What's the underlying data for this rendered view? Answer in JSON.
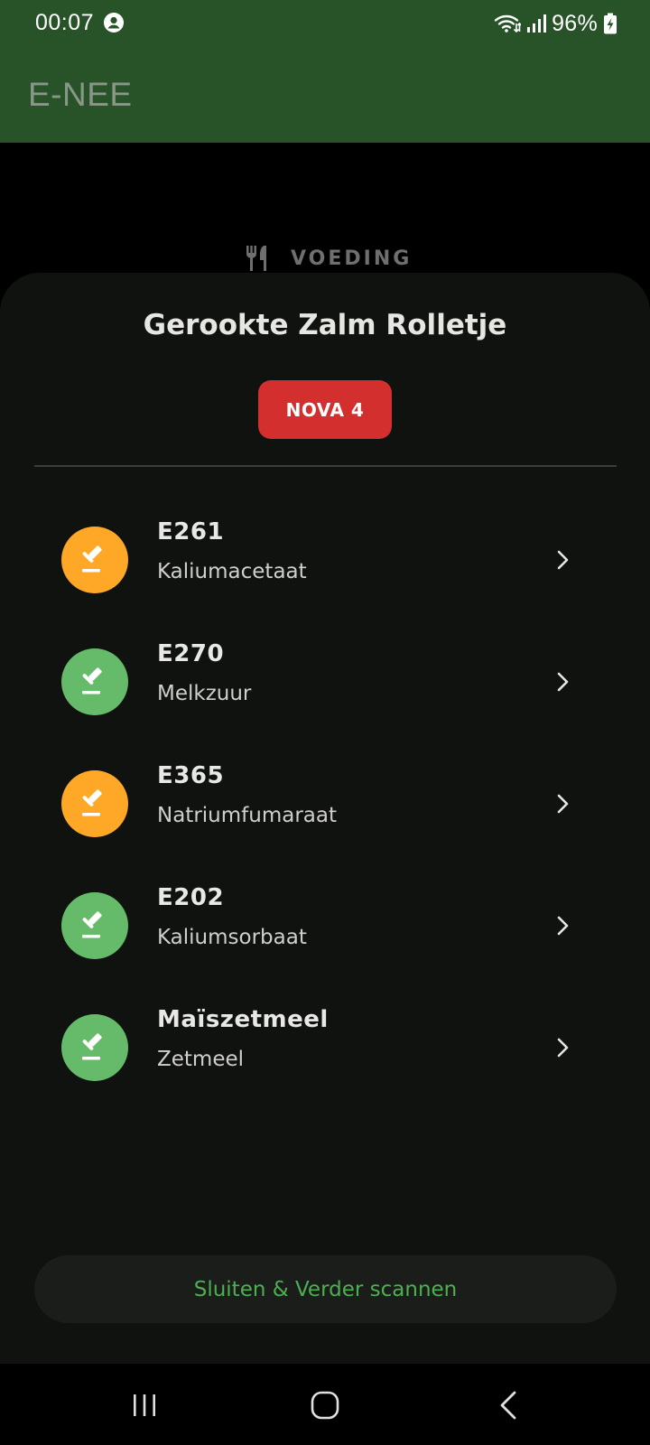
{
  "status_bar": {
    "time": "00:07",
    "battery_percent": "96%",
    "icons": [
      "account-icon",
      "wifi-icon",
      "signal-icon",
      "battery-charging-icon"
    ]
  },
  "app_bar": {
    "title": "E-NEE"
  },
  "category": {
    "label": "VOEDING",
    "icon": "fork-knife-icon"
  },
  "sheet": {
    "product_title": "Gerookte Zalm Rolletje",
    "nova_badge": "NOVA 4",
    "items": [
      {
        "code": "E261",
        "name": "Kaliumacetaat",
        "status_color": "#FFA726",
        "icon": "gavel-icon"
      },
      {
        "code": "E270",
        "name": "Melkzuur",
        "status_color": "#66BB6A",
        "icon": "gavel-icon"
      },
      {
        "code": "E365",
        "name": "Natriumfumaraat",
        "status_color": "#FFA726",
        "icon": "gavel-icon"
      },
      {
        "code": "E202",
        "name": "Kaliumsorbaat",
        "status_color": "#66BB6A",
        "icon": "gavel-icon"
      },
      {
        "code": "Maïszetmeel",
        "name": "Zetmeel",
        "status_color": "#66BB6A",
        "icon": "gavel-icon"
      }
    ],
    "close_button_label": "Sluiten & Verder scannen"
  },
  "colors": {
    "app_bar": "#285328",
    "sheet_background": "#0F120F",
    "nova_badge": "#D32F2F",
    "accent_green": "#4CAF50"
  }
}
